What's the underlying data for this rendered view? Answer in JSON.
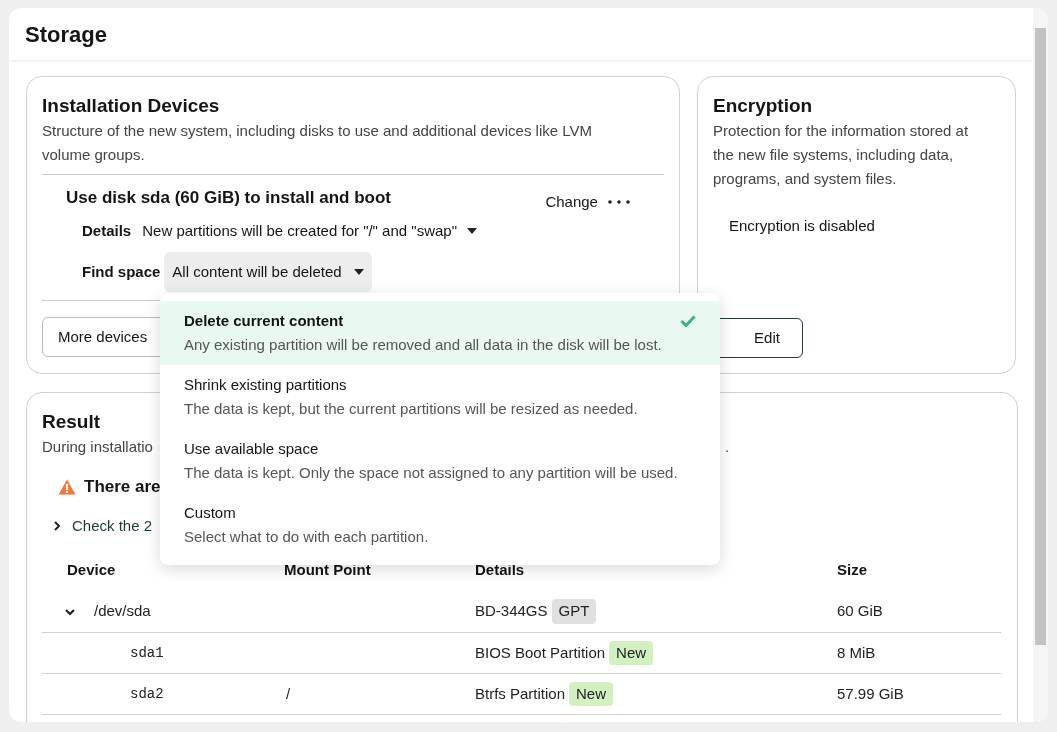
{
  "page": {
    "title": "Storage"
  },
  "installation_devices": {
    "title": "Installation Devices",
    "description": "Structure of the new system, including disks to use and additional devices like LVM volume groups.",
    "summary": "Use disk sda (60 GiB) to install and boot",
    "change_button": "Change",
    "details_label": "Details",
    "details_value": "New partitions will be created for \"/\" and \"swap\"",
    "find_space_label": "Find space",
    "find_space_value": "All content will be deleted",
    "more_devices_button": "More devices"
  },
  "find_space_menu": {
    "options": [
      {
        "label": "Delete current content",
        "description": "Any existing partition will be removed and all data in the disk will be lost.",
        "selected": true
      },
      {
        "label": "Shrink existing partitions",
        "description": "The data is kept, but the current partitions will be resized as needed.",
        "selected": false
      },
      {
        "label": "Use available space",
        "description": "The data is kept. Only the space not assigned to any partition will be used.",
        "selected": false
      },
      {
        "label": "Custom",
        "description": "Select what to do with each partition.",
        "selected": false
      }
    ]
  },
  "encryption": {
    "title": "Encryption",
    "description": "Protection for the information stored at the new file systems, including data, programs, and system files.",
    "status": "Encryption is disabled",
    "edit_button": "Edit"
  },
  "result": {
    "title": "Result",
    "description_start": "During installatio",
    "description_end": ".",
    "warning": "There are",
    "expander": {
      "label": "Check the 2",
      "expanded": false
    },
    "table": {
      "columns": [
        "Device",
        "Mount Point",
        "Details",
        "Size"
      ],
      "rows": [
        {
          "device": "/dev/sda",
          "details": "BD-344GS",
          "tag": {
            "label": "GPT",
            "kind": "neutral"
          },
          "size": "60 GiB",
          "expanded": true,
          "children": [
            {
              "device": "sda1",
              "details": "BIOS Boot Partition",
              "tag": {
                "label": "New",
                "kind": "new"
              },
              "size": "8 MiB"
            },
            {
              "device": "sda2",
              "mount_point": "/",
              "details": "Btrfs Partition",
              "tag": {
                "label": "New",
                "kind": "new"
              },
              "size": "57.99 GiB"
            }
          ]
        }
      ]
    }
  }
}
